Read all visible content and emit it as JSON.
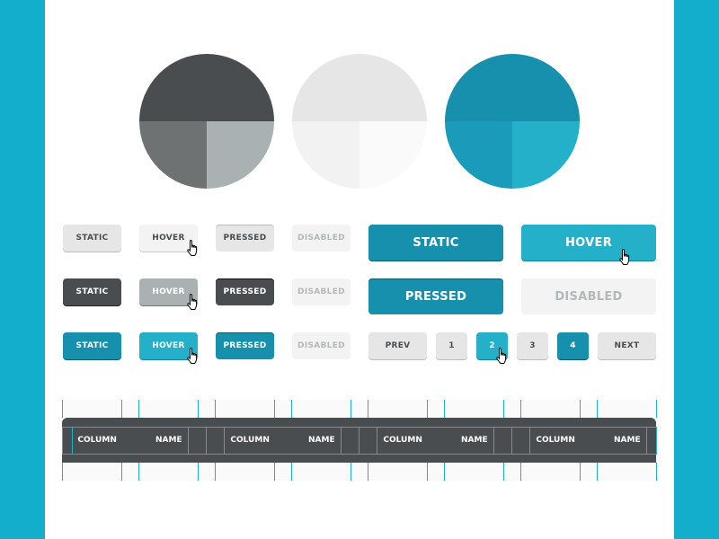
{
  "colors": {
    "background": "#12aecb",
    "dark": "#4a4d50",
    "accent": "#1790ae",
    "accent_hover": "#25b0ca",
    "light": "#e6e6e6"
  },
  "pies": [
    {
      "name": "gray",
      "colors": [
        "#4a4d50",
        "#6e7272",
        "#a9b1b2"
      ]
    },
    {
      "name": "light",
      "colors": [
        "#e6e6e6",
        "#f2f2f2",
        "#fafafa"
      ]
    },
    {
      "name": "blue",
      "colors": [
        "#1790ae",
        "#1b9bba",
        "#25b0ca"
      ]
    }
  ],
  "small_buttons": {
    "gray": [
      "STATIC",
      "HOVER",
      "PRESSED",
      "DISABLED"
    ],
    "dark": [
      "STATIC",
      "HOVER",
      "PRESSED",
      "DISABLED"
    ],
    "blue": [
      "STATIC",
      "HOVER",
      "PRESSED",
      "DISABLED"
    ]
  },
  "large_buttons": [
    "STATIC",
    "HOVER",
    "PRESSED",
    "DISABLED"
  ],
  "pagination": {
    "prev": "PREV",
    "pages": [
      "1",
      "2",
      "3",
      "4"
    ],
    "next": "NEXT",
    "hover_page": "2",
    "active_page": "4"
  },
  "table": {
    "columns": [
      "COLUMN NAME",
      "COLUMN NAME",
      "COLUMN NAME",
      "COLUMN NAME"
    ]
  },
  "icons": {
    "cursor": "hand-pointer-icon"
  }
}
